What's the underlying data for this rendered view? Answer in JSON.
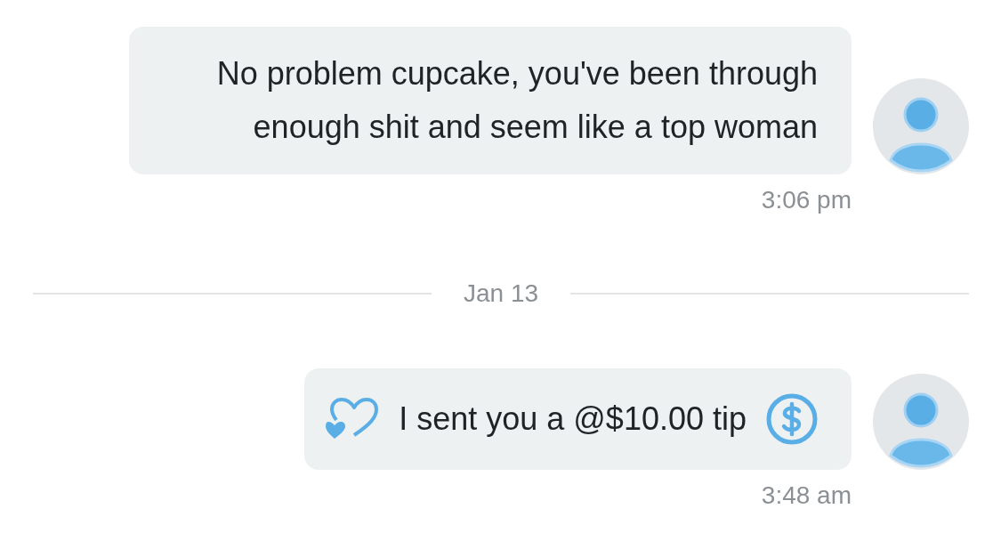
{
  "thread": [
    {
      "kind": "message",
      "text": "No problem cupcake, you've been through enough shit and seem like a top woman",
      "time": "3:06 pm"
    },
    {
      "kind": "date_divider",
      "label": "Jan 13"
    },
    {
      "kind": "tip",
      "text": "I sent you a @$10.00 tip",
      "time": "3:48 am"
    }
  ]
}
